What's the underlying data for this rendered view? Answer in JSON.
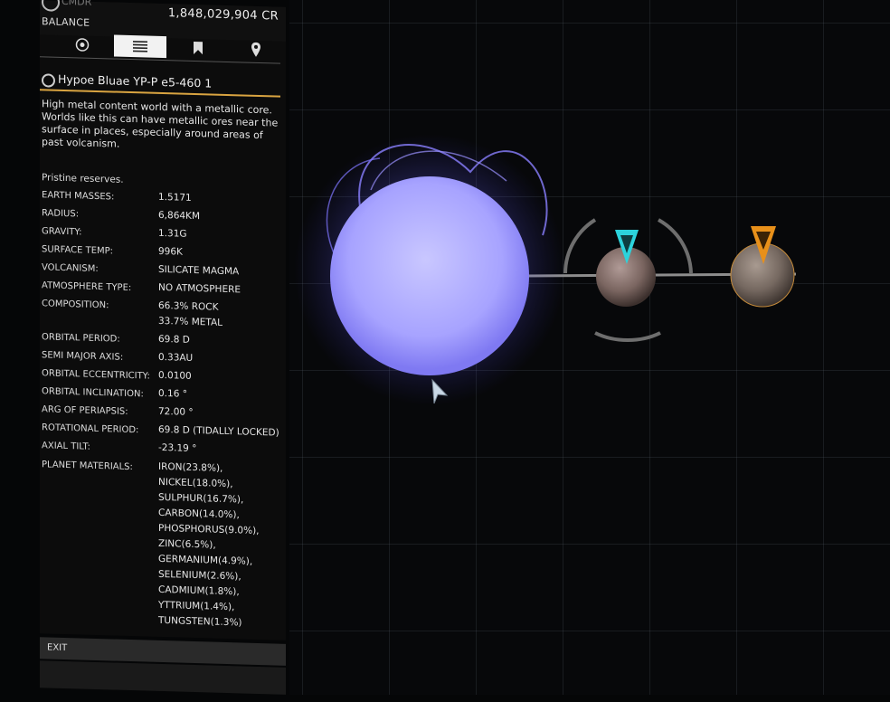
{
  "header": {
    "subtitle": "CMDR",
    "balance_label": "BALANCE",
    "balance_value": "1,848,029,904 CR"
  },
  "tabs": [
    {
      "icon": "target-icon",
      "active": false
    },
    {
      "icon": "list-icon",
      "active": true
    },
    {
      "icon": "bookmark-icon",
      "active": false
    },
    {
      "icon": "map-pin-icon",
      "active": false
    }
  ],
  "body": {
    "name": "Hypoe Bluae YP-P e5-460 1",
    "description": "High metal content world with a metallic core. Worlds like this can have metallic ores near the surface in places, especially around areas of past volcanism.",
    "reserves": "Pristine reserves.",
    "stats": [
      {
        "label": "EARTH MASSES:",
        "value": "1.5171"
      },
      {
        "label": "RADIUS:",
        "value": "6,864KM"
      },
      {
        "label": "GRAVITY:",
        "value": "1.31G"
      },
      {
        "label": "SURFACE TEMP:",
        "value": "996K"
      },
      {
        "label": "VOLCANISM:",
        "value": "SILICATE MAGMA"
      },
      {
        "label": "ATMOSPHERE TYPE:",
        "value": "NO ATMOSPHERE"
      },
      {
        "label": "COMPOSITION:",
        "value": "66.3% ROCK\n33.7% METAL"
      },
      {
        "label": "ORBITAL PERIOD:",
        "value": "69.8 D"
      },
      {
        "label": "SEMI MAJOR AXIS:",
        "value": "0.33AU"
      },
      {
        "label": "ORBITAL ECCENTRICITY:",
        "value": "0.0100"
      },
      {
        "label": "ORBITAL INCLINATION:",
        "value": "0.16 °"
      },
      {
        "label": "ARG OF PERIAPSIS:",
        "value": "72.00 °"
      },
      {
        "label": "ROTATIONAL PERIOD:",
        "value": "69.8 D (TIDALLY LOCKED)"
      },
      {
        "label": "AXIAL TILT:",
        "value": "-23.19 °"
      },
      {
        "label": "PLANET MATERIALS:",
        "value": "IRON(23.8%),\nNICKEL(18.0%),\nSULPHUR(16.7%),\nCARBON(14.0%),\nPHOSPHORUS(9.0%),\nZINC(6.5%),\nGERMANIUM(4.9%),\nSELENIUM(2.6%),\nCADMIUM(1.8%),\nYTTRIUM(1.4%),\nTUNGSTEN(1.3%)"
      }
    ]
  },
  "footer": {
    "exit_label": "EXIT"
  },
  "colors": {
    "accent_orange": "#e8901a",
    "accent_cyan": "#2cd3dc",
    "star_blue": "#b8b6ff",
    "title_underline": "#d9a441"
  }
}
